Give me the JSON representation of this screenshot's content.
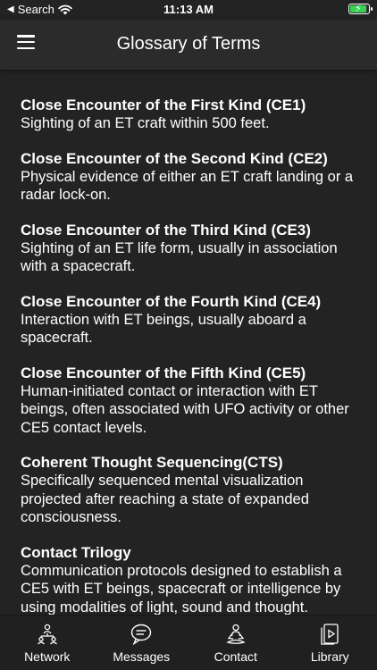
{
  "status_bar": {
    "carrier": "Search",
    "time": "11:13 AM"
  },
  "header": {
    "title": "Glossary of Terms"
  },
  "terms": [
    {
      "title": "Close Encounter of the First Kind (CE1)",
      "definition": "Sighting of an ET craft within 500 feet."
    },
    {
      "title": "Close Encounter of the Second Kind (CE2)",
      "definition": "Physical evidence of either an ET craft landing or a radar lock-on."
    },
    {
      "title": "Close Encounter of the Third Kind (CE3)",
      "definition": "Sighting of an ET life form, usually in association with a spacecraft."
    },
    {
      "title": "Close Encounter of the Fourth Kind (CE4)",
      "definition": "Interaction with ET beings, usually aboard a spacecraft."
    },
    {
      "title": "Close Encounter of the Fifth Kind (CE5)",
      "definition": "Human-initiated contact or interaction with ET beings, often associated with UFO activity or other CE5 contact levels."
    },
    {
      "title": "Coherent Thought Sequencing(CTS)",
      "definition": "Specifically sequenced mental visualization projected after reaching a state of expanded consciousness."
    },
    {
      "title": "Contact Trilogy",
      "definition": "Communication protocols designed to establish a CE5 with ET beings, spacecraft or intelligence by using modalities of light, sound and thought."
    }
  ],
  "tabs": [
    {
      "label": "Network",
      "icon": "network-icon"
    },
    {
      "label": "Messages",
      "icon": "chat-bubble-icon"
    },
    {
      "label": "Contact",
      "icon": "meditation-icon"
    },
    {
      "label": "Library",
      "icon": "media-library-icon"
    }
  ],
  "colors": {
    "background": "#232323",
    "nav_bar": "#2b2b2b",
    "tab_bar": "#202020",
    "battery": "#39d353"
  }
}
